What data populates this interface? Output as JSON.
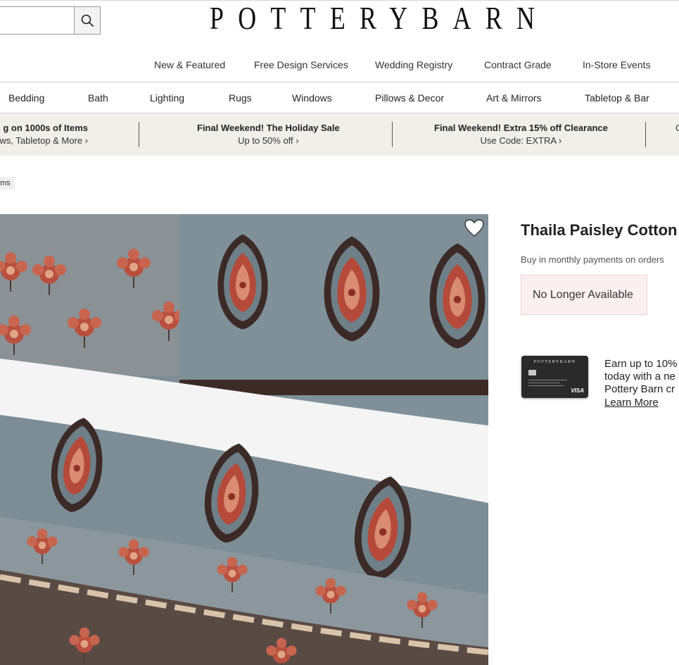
{
  "header": {
    "logo_text": "POTTERYBARN",
    "search": {
      "placeholder": "",
      "value": "",
      "button_icon": "search-icon"
    }
  },
  "utility_nav": [
    "New & Featured",
    "Free Design Services",
    "Wedding Registry",
    "Contract Grade",
    "In-Store Events"
  ],
  "category_nav": [
    "Bedding",
    "Bath",
    "Lighting",
    "Rugs",
    "Windows",
    "Pillows & Decor",
    "Art & Mirrors",
    "Tabletop & Bar"
  ],
  "promos": [
    {
      "title": "g on 1000s of Items",
      "subtitle": "ws, Tabletop & More ›"
    },
    {
      "title": "Final Weekend! The Holiday Sale",
      "subtitle": "Up to 50% off ›"
    },
    {
      "title": "Final Weekend! Extra 15% off Clearance",
      "subtitle": "Use Code: EXTRA ›"
    },
    {
      "title": "",
      "subtitle": "C"
    }
  ],
  "breadcrumb": "ms",
  "product": {
    "title": "Thaila Paisley Cotton",
    "installments": "Buy in monthly payments on orders",
    "availability": "No Longer Available",
    "favorite_icon": "heart-icon"
  },
  "credit_promo": {
    "card_brand": "POTTERYBARN",
    "card_network": "VISA",
    "lines": [
      "Earn up to 10%",
      "today with a ne",
      "Pottery Barn cr"
    ],
    "link": "Learn More"
  },
  "colors": {
    "promo_bg": "#f1efea",
    "availability_bg": "#fbf0f0",
    "fabric_blue": "#7d8d96",
    "paisley_red": "#b54a3a",
    "paisley_dark": "#3b2a26"
  }
}
